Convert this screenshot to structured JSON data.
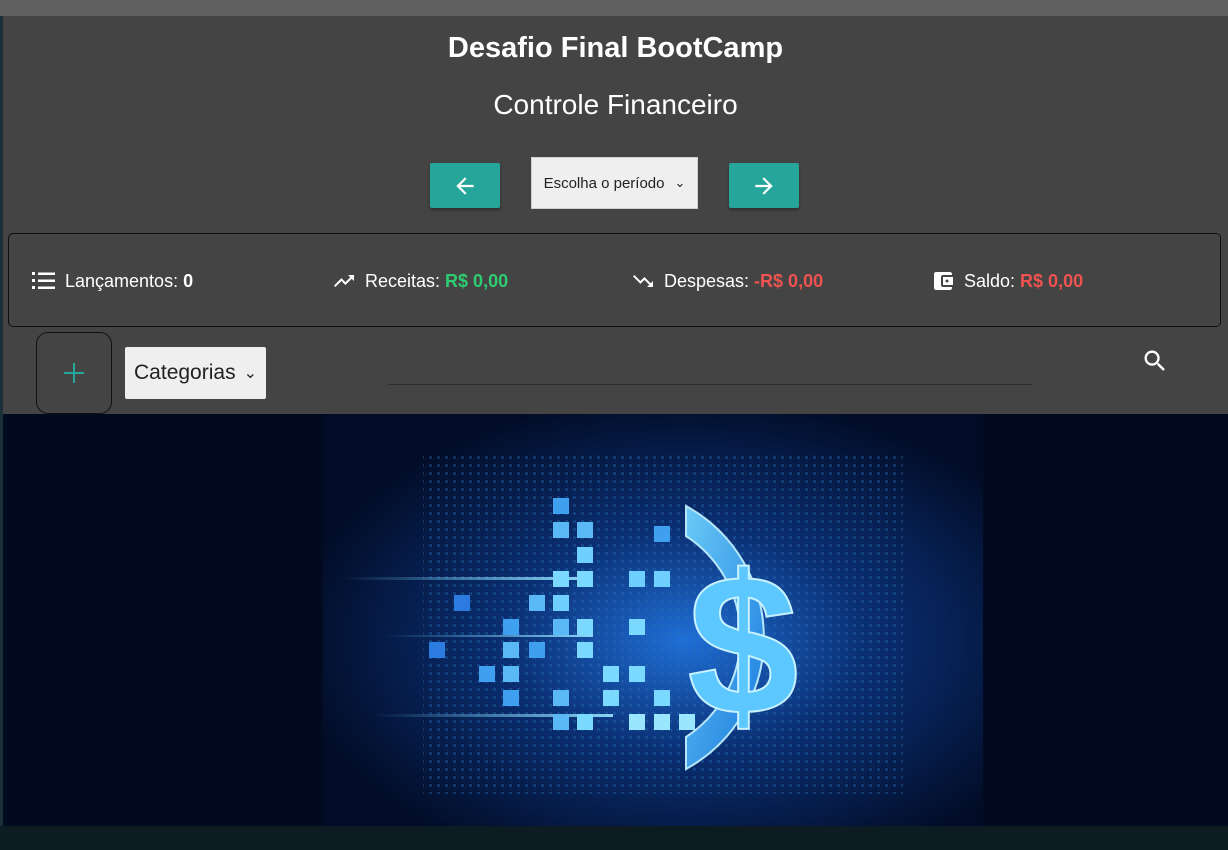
{
  "header": {
    "title": "Desafio Final BootCamp",
    "subtitle": "Controle Financeiro"
  },
  "period": {
    "prev_icon": "arrow-left-icon",
    "next_icon": "arrow-right-icon",
    "select_label": "Escolha o período"
  },
  "summary": {
    "entries_label": "Lançamentos:",
    "entries_value": "0",
    "income_label": "Receitas:",
    "income_value": "R$ 0,00",
    "expenses_label": "Despesas:",
    "expenses_value": "-R$ 0,00",
    "balance_label": "Saldo:",
    "balance_value": "R$ 0,00"
  },
  "toolbar": {
    "add_icon": "plus-icon",
    "categories_label": "Categorias",
    "search_icon": "search-icon"
  },
  "colors": {
    "panel": "#444444",
    "accent": "#26a69a",
    "positive": "#2ecc71",
    "negative": "#ef5350"
  }
}
